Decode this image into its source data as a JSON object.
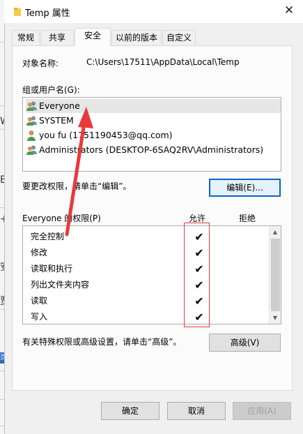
{
  "background": {
    "fragments": [
      "W",
      "E",
      "+",
      "安",
      "贾",
      "页"
    ]
  },
  "window": {
    "title": "Temp 属性",
    "close_glyph": "✕"
  },
  "tabs": [
    {
      "label": "常规",
      "active": false
    },
    {
      "label": "共享",
      "active": false
    },
    {
      "label": "安全",
      "active": true
    },
    {
      "label": "以前的版本",
      "active": false
    },
    {
      "label": "自定义",
      "active": false
    }
  ],
  "security": {
    "object_name_label": "对象名称:",
    "object_name_value": "C:\\Users\\17511\\AppData\\Local\\Temp",
    "group_label": "组或用户名(G):",
    "users": [
      {
        "name": "Everyone",
        "icon": "group-icon",
        "selected": true
      },
      {
        "name": "SYSTEM",
        "icon": "group-icon",
        "selected": false
      },
      {
        "name": "you fu (1751190453@qq.com)",
        "icon": "user-icon",
        "selected": false
      },
      {
        "name": "Administrators (DESKTOP-6SAQ2RV\\Administrators)",
        "icon": "group-icon",
        "selected": false
      }
    ],
    "edit_hint": "要更改权限，请单击“编辑”。",
    "edit_button": "编辑(E)...",
    "permissions_label": "Everyone 的权限(P)",
    "allow_header": "允许",
    "deny_header": "拒绝",
    "permissions": [
      {
        "name": "完全控制",
        "allow": true,
        "deny": false
      },
      {
        "name": "修改",
        "allow": true,
        "deny": false
      },
      {
        "name": "读取和执行",
        "allow": true,
        "deny": false
      },
      {
        "name": "列出文件夹内容",
        "allow": true,
        "deny": false
      },
      {
        "name": "读取",
        "allow": true,
        "deny": false
      },
      {
        "name": "写入",
        "allow": true,
        "deny": false
      }
    ],
    "check_glyph": "✔",
    "advanced_hint": "有关特殊权限或高级设置，请单击“高级”。",
    "advanced_button": "高级(V)"
  },
  "footer": {
    "ok": "确定",
    "cancel": "取消",
    "apply": "应用(A)"
  },
  "annotation": {
    "color": "#e83a3a"
  }
}
